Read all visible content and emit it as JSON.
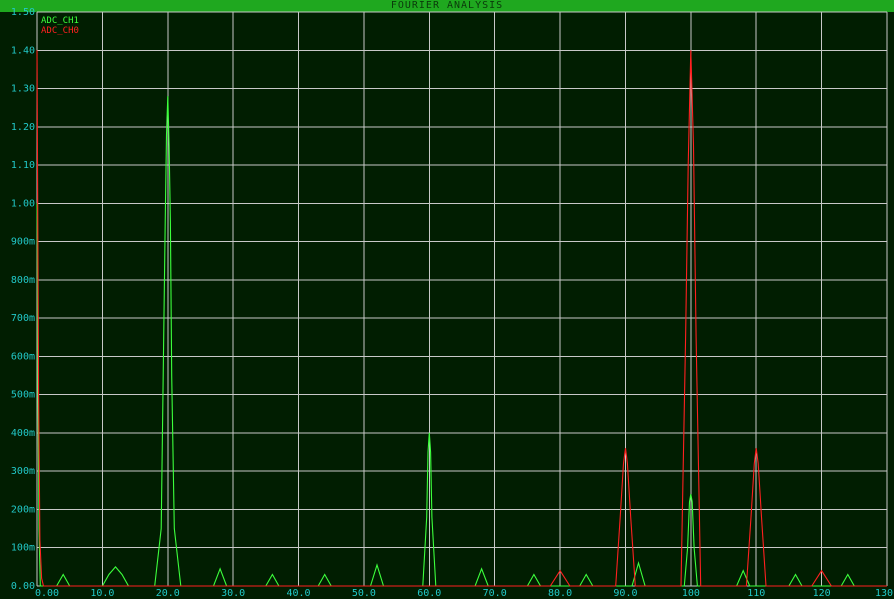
{
  "window": {
    "title": "FOURIER ANALYSIS"
  },
  "colors": {
    "background": "#011e01",
    "grid": "#c8c8c8",
    "axis_text": "#22c9c9",
    "title_bar": "#1fa81f",
    "title_text": "#0b3a0b",
    "adc_ch1": "#3cff3c",
    "adc_ch0": "#ff2020"
  },
  "chart_data": {
    "type": "line",
    "title": "FOURIER ANALYSIS",
    "xlabel": "",
    "ylabel": "",
    "xlim": [
      0,
      130
    ],
    "ylim": [
      0,
      1.5
    ],
    "grid": true,
    "legend_position": "top-left",
    "x_ticks": [
      0,
      10,
      20,
      30,
      40,
      50,
      60,
      70,
      80,
      90,
      100,
      110,
      120,
      130
    ],
    "x_tick_labels": [
      "0.00",
      "10.0",
      "20.0",
      "30.0",
      "40.0",
      "50.0",
      "60.0",
      "70.0",
      "80.0",
      "90.0",
      "100",
      "110",
      "120",
      "130"
    ],
    "y_ticks": [
      0,
      0.1,
      0.2,
      0.3,
      0.4,
      0.5,
      0.6,
      0.7,
      0.8,
      0.9,
      1.0,
      1.1,
      1.2,
      1.3,
      1.4,
      1.5
    ],
    "y_tick_labels": [
      "0.00",
      "100m",
      "200m",
      "300m",
      "400m",
      "500m",
      "600m",
      "700m",
      "800m",
      "900m",
      "1.00",
      "1.10",
      "1.20",
      "1.30",
      "1.40",
      "1.50"
    ],
    "series": [
      {
        "name": "ADC_CH1",
        "x": [
          0,
          0.05,
          0.15,
          0.3,
          0.5,
          3,
          4,
          5,
          10,
          11,
          12,
          13,
          14,
          18,
          19,
          19.3,
          19.6,
          19.8,
          20,
          20.2,
          20.4,
          20.6,
          21,
          22,
          27,
          28,
          29,
          35,
          36,
          37,
          43,
          44,
          45,
          51,
          52,
          53,
          59,
          59.6,
          59.8,
          60,
          60.2,
          60.4,
          61,
          67,
          68,
          69,
          75,
          76,
          77,
          83,
          84,
          85,
          91,
          92,
          93,
          99,
          99.5,
          99.8,
          100,
          100.2,
          100.5,
          101,
          107,
          108,
          109,
          115,
          116,
          117,
          123,
          124,
          125,
          130
        ],
        "y": [
          1.0,
          0.9,
          0.5,
          0.15,
          0,
          0,
          0.03,
          0,
          0,
          0.03,
          0.05,
          0.03,
          0,
          0,
          0.15,
          0.55,
          0.95,
          1.18,
          1.28,
          1.15,
          0.95,
          0.55,
          0.15,
          0,
          0,
          0.045,
          0,
          0,
          0.03,
          0,
          0,
          0.03,
          0,
          0,
          0.055,
          0,
          0,
          0.18,
          0.35,
          0.4,
          0.35,
          0.18,
          0,
          0,
          0.045,
          0,
          0,
          0.03,
          0,
          0,
          0.03,
          0,
          0,
          0.06,
          0,
          0,
          0.1,
          0.22,
          0.24,
          0.22,
          0.1,
          0,
          0,
          0.04,
          0,
          0,
          0.03,
          0,
          0,
          0.03,
          0,
          0
        ]
      },
      {
        "name": "ADC_CH0",
        "x": [
          0,
          0.1,
          0.25,
          0.45,
          0.7,
          1,
          78.5,
          80,
          81.5,
          88.5,
          89.2,
          89.7,
          90,
          90.3,
          90.8,
          91.5,
          98.5,
          99.2,
          99.6,
          100,
          100.4,
          100.8,
          101.5,
          108.5,
          109.2,
          109.7,
          110,
          110.3,
          110.8,
          111.5,
          118.5,
          120,
          121.5,
          130
        ],
        "y": [
          1.4,
          1.0,
          0.5,
          0.12,
          0.02,
          0,
          0,
          0.04,
          0,
          0,
          0.18,
          0.32,
          0.36,
          0.32,
          0.18,
          0,
          0,
          0.65,
          1.1,
          1.4,
          1.15,
          0.65,
          0,
          0,
          0.18,
          0.32,
          0.36,
          0.32,
          0.18,
          0,
          0,
          0.04,
          0,
          0
        ]
      }
    ]
  }
}
